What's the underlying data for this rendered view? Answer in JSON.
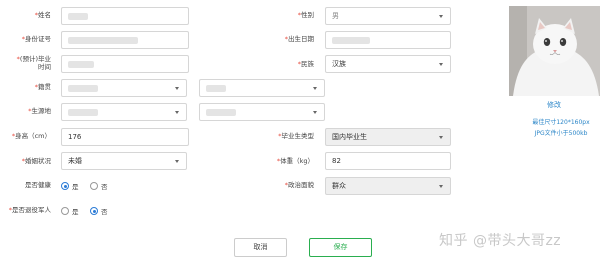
{
  "form": {
    "name_label": "姓名",
    "gender_label": "性别",
    "gender_value": "男",
    "id_label": "身份证号",
    "birth_label": "出生日期",
    "grad_time_label": "(预计)毕业时间",
    "ethnicity_label": "民族",
    "ethnicity_value": "汉族",
    "native_label": "籍贯",
    "origin_label": "生源地",
    "height_label": "身高（cm）",
    "height_value": "176",
    "grad_type_label": "毕业生类型",
    "grad_type_value": "国内毕业生",
    "marital_label": "婚姻状况",
    "marital_value": "未婚",
    "weight_label": "体重（kg）",
    "weight_value": "82",
    "healthy_label": "是否健康",
    "political_label": "政治面貌",
    "political_value": "群众",
    "veteran_label": "是否退役军人",
    "yes": "是",
    "no": "否",
    "healthy_selected": "yes",
    "veteran_selected": "no"
  },
  "photo": {
    "edit_link": "修改",
    "hint_size": "最佳尺寸120*160px",
    "hint_file": "JPG文件小于500kb"
  },
  "actions": {
    "cancel": "取消",
    "save": "保存"
  },
  "watermark": "知乎 @带头大哥zz",
  "colors": {
    "required": "#e64a3c",
    "link": "#2b86c8",
    "save": "#2aae4f",
    "radio_on": "#2b7bd6"
  }
}
